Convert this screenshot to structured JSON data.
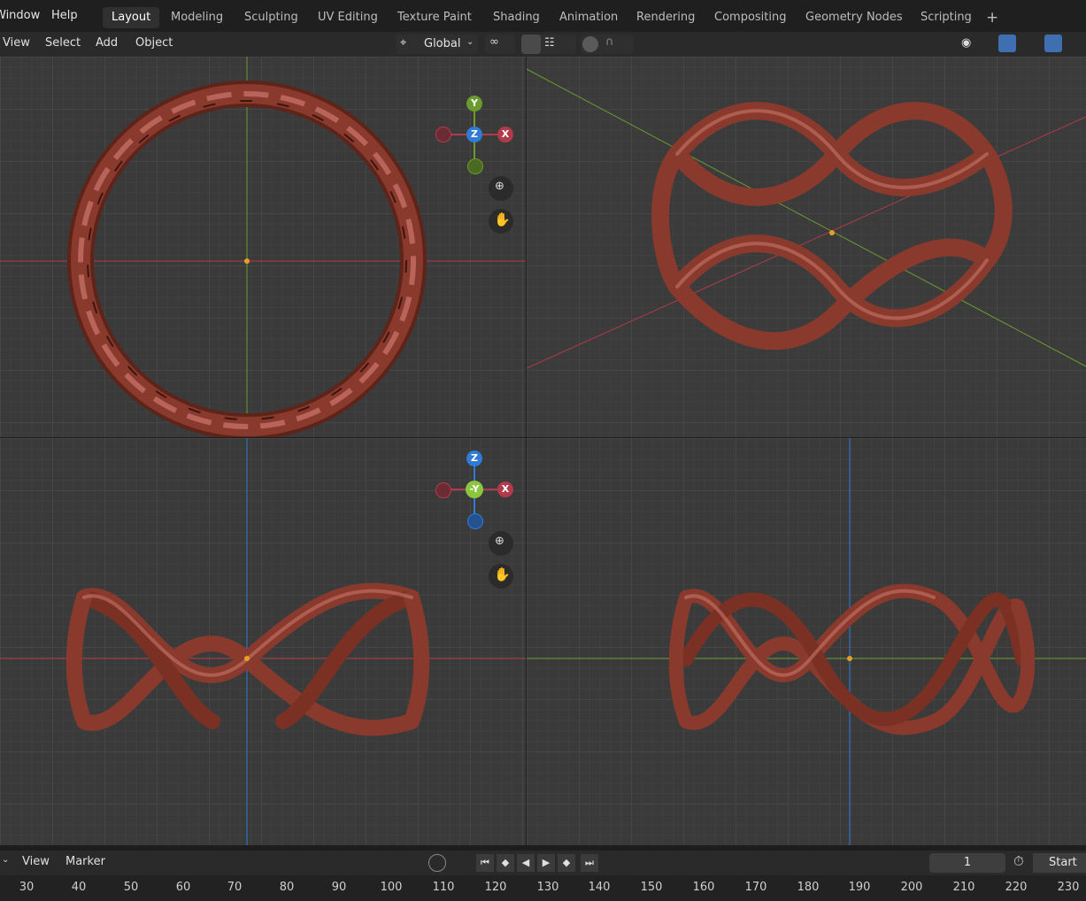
{
  "menu": {
    "window": "Window",
    "help": "Help"
  },
  "workspace_tabs": [
    "Layout",
    "Modeling",
    "Sculpting",
    "UV Editing",
    "Texture Paint",
    "Shading",
    "Animation",
    "Rendering",
    "Compositing",
    "Geometry Nodes",
    "Scripting"
  ],
  "active_tab": "Layout",
  "add_workspace": "+",
  "header": {
    "view": "View",
    "select": "Select",
    "add": "Add",
    "object": "Object",
    "orientation": "Global"
  },
  "gizmo_top": {
    "y": "Y",
    "z": "Z",
    "x": "X"
  },
  "gizmo_front": {
    "z": "Z",
    "y": "-Y",
    "x": "X"
  },
  "timeline": {
    "view": "View",
    "marker": "Marker",
    "frame": "1",
    "start": "Start"
  },
  "ruler_ticks": [
    "30",
    "40",
    "50",
    "60",
    "70",
    "80",
    "90",
    "100",
    "110",
    "120",
    "130",
    "140",
    "150",
    "160",
    "170",
    "180",
    "190",
    "200",
    "210",
    "220",
    "230"
  ],
  "colors": {
    "ring": "#8a3a2c",
    "ring_highlight": "#c9756a",
    "axis_x": "#b23b4b",
    "axis_y": "#6b9a2f",
    "axis_z": "#2f7bd6",
    "active_tab": "#303030"
  },
  "icons": [
    "transform-orientation-icon",
    "snap-icon",
    "proportional-edit-icon",
    "visibility-icon",
    "gizmo-icon",
    "overlay-icon",
    "zoom-icon",
    "hand-pan-icon",
    "timer-icon"
  ]
}
